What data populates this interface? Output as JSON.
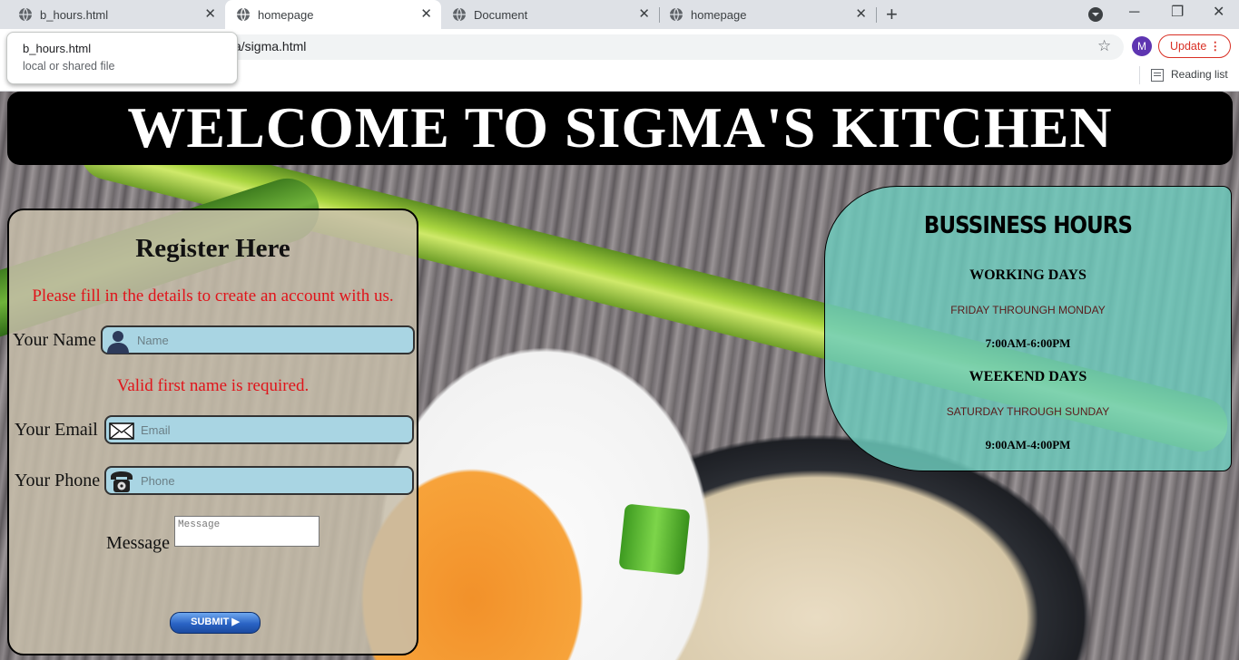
{
  "browser": {
    "tabs": [
      {
        "title": "b_hours.html",
        "active": false
      },
      {
        "title": "homepage",
        "active": true
      },
      {
        "title": "Document",
        "active": false
      },
      {
        "title": "homepage",
        "active": false
      }
    ],
    "new_tab_label": "+",
    "address": "a/sigma.html",
    "avatar_letter": "M",
    "update_label": "Update",
    "reading_list_label": "Reading list",
    "tooltip": {
      "title": "b_hours.html",
      "subtitle": "local or shared file"
    }
  },
  "page": {
    "header": "WELCOME TO SIGMA'S KITCHEN",
    "register": {
      "title": "Register Here",
      "subtitle": "Please fill in the details to create an account with us.",
      "name_label": "Your Name",
      "name_placeholder": "Name",
      "name_error": "Valid first name is required.",
      "email_label": "Your Email",
      "email_placeholder": "Email",
      "phone_label": "Your Phone",
      "phone_placeholder": "Phone",
      "message_label": "Message",
      "message_placeholder": "Message",
      "submit_label": "SUBMIT ▶"
    },
    "hours": {
      "title": "BUSSINESS HOURS",
      "working_heading": "WORKING DAYS",
      "working_days": "FRIDAY THROUNGH MONDAY",
      "working_time": "7:00AM-6:00PM",
      "weekend_heading": "WEEKEND DAYS",
      "weekend_days": "SATURDAY THROUGH SUNDAY",
      "weekend_time": "9:00AM-4:00PM"
    }
  },
  "colors": {
    "error_text": "#e0141a",
    "input_bg": "#a9d5e3",
    "hours_panel": "#6ecdbe",
    "header_bg": "#000000",
    "update_accent": "#d93025",
    "avatar_bg": "#5e35b1"
  }
}
